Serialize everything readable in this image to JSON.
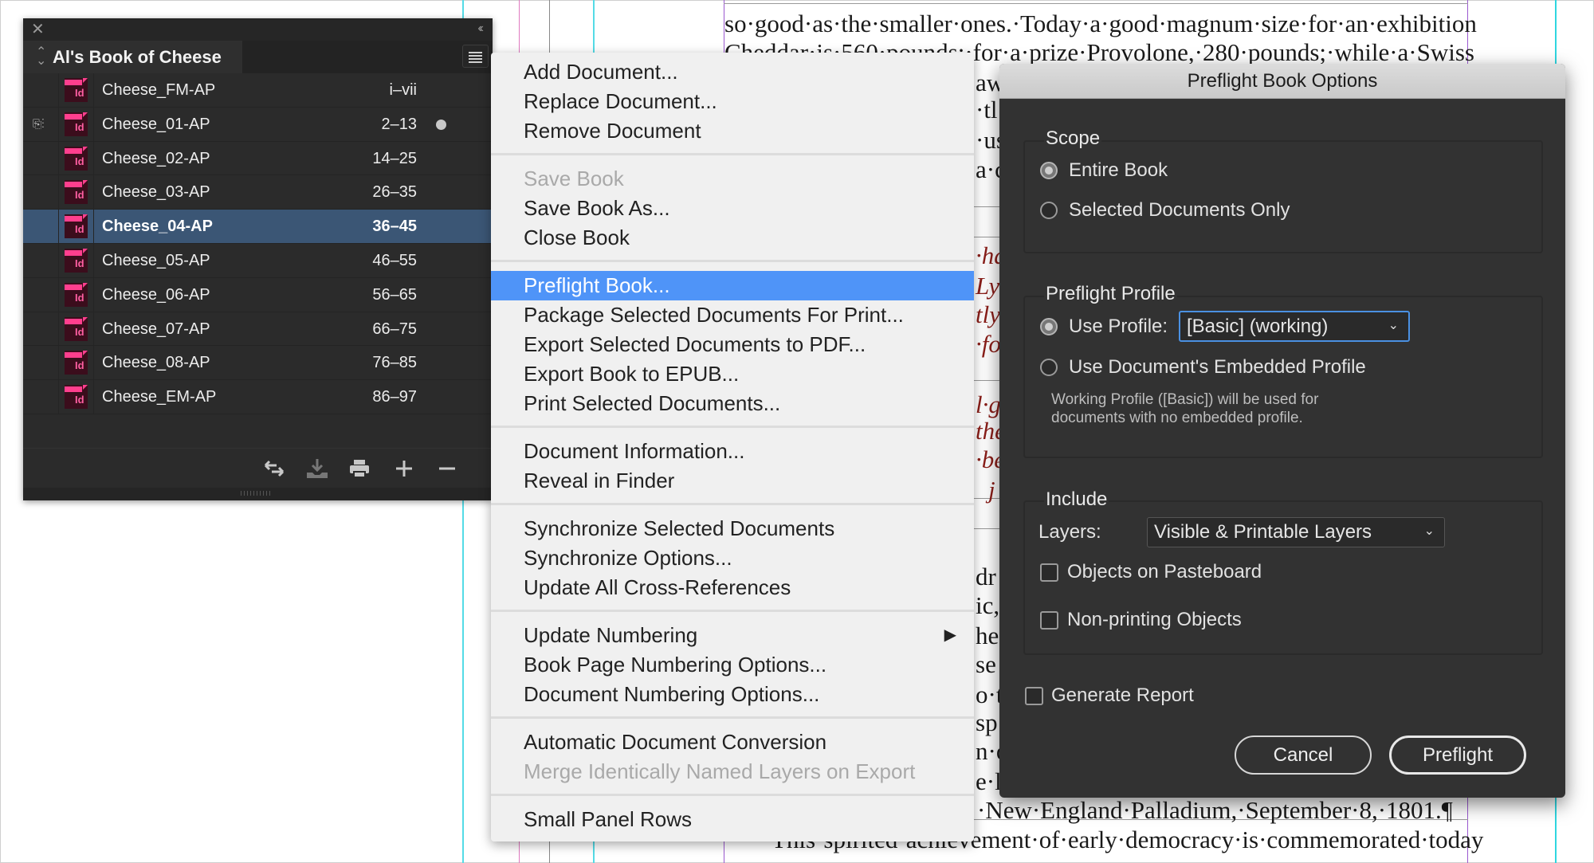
{
  "document": {
    "lines": [
      "so·good·as·the·smaller·ones.·Today·a·good·magnum·size·for·an·exhibition",
      "Cheddar·is·560·pounds;·for·a·prize·Provolone,·280·pounds;·while·a·Swiss",
      "·New·England·Palladium,·September·8,·1801.¶",
      "This·spirited·achievement·of·early·democracy·is·commemorated·today"
    ],
    "fragments": [
      "aw",
      "·tl",
      "·us",
      "a·c",
      "·ha",
      "Ly",
      "tly",
      "·fo",
      "l·g",
      "the",
      "·be",
      "j",
      "dr",
      "ic,",
      "he",
      "se",
      "o·t",
      "sp",
      "n·o",
      "e·l"
    ],
    "colors": {
      "body_text": "#1a1a1a",
      "italic_text": "#8b1f1a",
      "margin_guide": "#9b59d0",
      "column_guide": "#2fd6e0"
    }
  },
  "book_panel": {
    "title": "Al's Book of Cheese",
    "close_icon": "close-icon",
    "collapse_icon": "double-chevron-left-icon",
    "menu_icon": "hamburger-icon",
    "documents": [
      {
        "name": "Cheese_FM-AP",
        "pages": "i–vii",
        "selected": false,
        "syncing": false,
        "modified": false
      },
      {
        "name": "Cheese_01-AP",
        "pages": "2–13",
        "selected": false,
        "syncing": true,
        "modified": true
      },
      {
        "name": "Cheese_02-AP",
        "pages": "14–25",
        "selected": false,
        "syncing": false,
        "modified": false
      },
      {
        "name": "Cheese_03-AP",
        "pages": "26–35",
        "selected": false,
        "syncing": false,
        "modified": false
      },
      {
        "name": "Cheese_04-AP",
        "pages": "36–45",
        "selected": true,
        "syncing": false,
        "modified": false
      },
      {
        "name": "Cheese_05-AP",
        "pages": "46–55",
        "selected": false,
        "syncing": false,
        "modified": false
      },
      {
        "name": "Cheese_06-AP",
        "pages": "56–65",
        "selected": false,
        "syncing": false,
        "modified": false
      },
      {
        "name": "Cheese_07-AP",
        "pages": "66–75",
        "selected": false,
        "syncing": false,
        "modified": false
      },
      {
        "name": "Cheese_08-AP",
        "pages": "76–85",
        "selected": false,
        "syncing": false,
        "modified": false
      },
      {
        "name": "Cheese_EM-AP",
        "pages": "86–97",
        "selected": false,
        "syncing": false,
        "modified": false
      }
    ],
    "doc_icon_text": "Id",
    "footer_icons": [
      "synchronize-icon",
      "save-book-icon",
      "print-icon",
      "add-document-icon",
      "remove-document-icon"
    ],
    "selected_color": "#3b5675"
  },
  "context_menu": {
    "groups": [
      [
        {
          "label": "Add Document..."
        },
        {
          "label": "Replace Document..."
        },
        {
          "label": "Remove Document"
        }
      ],
      [
        {
          "label": "Save Book",
          "disabled": true
        },
        {
          "label": "Save Book As..."
        },
        {
          "label": "Close Book"
        }
      ],
      [
        {
          "label": "Preflight Book...",
          "highlighted": true
        },
        {
          "label": "Package Selected Documents For Print..."
        },
        {
          "label": "Export Selected Documents to PDF..."
        },
        {
          "label": "Export Book to EPUB..."
        },
        {
          "label": "Print Selected Documents..."
        }
      ],
      [
        {
          "label": "Document Information..."
        },
        {
          "label": "Reveal in Finder"
        }
      ],
      [
        {
          "label": "Synchronize Selected Documents"
        },
        {
          "label": "Synchronize Options..."
        },
        {
          "label": "Update All Cross-References"
        }
      ],
      [
        {
          "label": "Update Numbering",
          "submenu": true
        },
        {
          "label": "Book Page Numbering Options..."
        },
        {
          "label": "Document Numbering Options..."
        }
      ],
      [
        {
          "label": "Automatic Document Conversion"
        },
        {
          "label": "Merge Identically Named Layers on Export",
          "disabled": true
        }
      ],
      [
        {
          "label": "Small Panel Rows"
        }
      ]
    ],
    "highlight_color": "#4f94f8"
  },
  "dialog": {
    "title": "Preflight Book Options",
    "scope": {
      "legend": "Scope",
      "options": [
        {
          "label": "Entire Book",
          "checked": true
        },
        {
          "label": "Selected Documents Only",
          "checked": false
        }
      ]
    },
    "profile": {
      "legend": "Preflight Profile",
      "use_profile_label": "Use Profile:",
      "use_profile_checked": true,
      "profile_value": "[Basic] (working)",
      "embedded_label": "Use Document's Embedded Profile",
      "embedded_checked": false,
      "note_line1": "Working Profile ([Basic]) will be used for",
      "note_line2": "documents with no embedded profile."
    },
    "include": {
      "legend": "Include",
      "layers_label": "Layers:",
      "layers_value": "Visible & Printable Layers",
      "objects_on_pasteboard": {
        "label": "Objects on Pasteboard",
        "checked": false
      },
      "non_printing_objects": {
        "label": "Non-printing Objects",
        "checked": false
      }
    },
    "generate_report": {
      "label": "Generate Report",
      "checked": false
    },
    "cancel_label": "Cancel",
    "preflight_label": "Preflight",
    "focus_color": "#4a90e2"
  }
}
